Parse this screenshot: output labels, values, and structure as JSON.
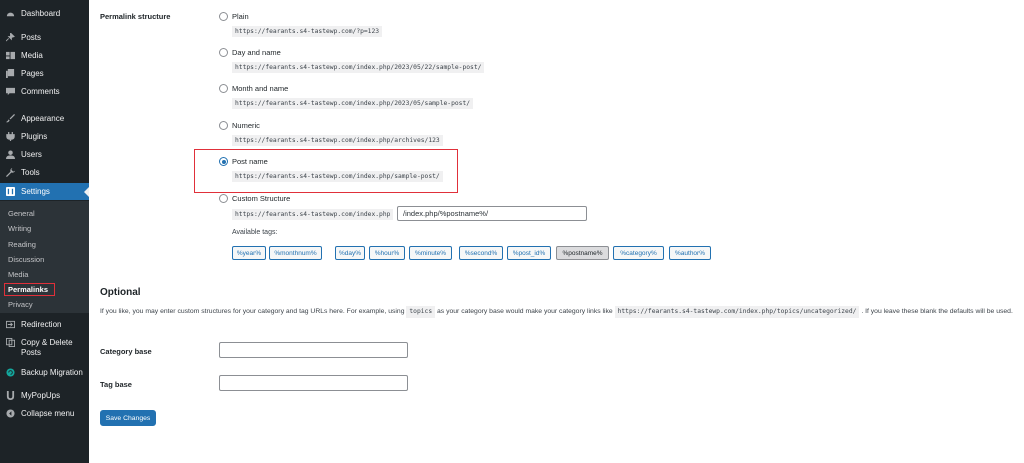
{
  "sidebar": {
    "items": [
      {
        "label": "Dashboard",
        "icon": "dashboard-icon"
      },
      {
        "label": "Posts",
        "icon": "pin-icon"
      },
      {
        "label": "Media",
        "icon": "media-icon"
      },
      {
        "label": "Pages",
        "icon": "pages-icon"
      },
      {
        "label": "Comments",
        "icon": "comment-icon"
      },
      {
        "label": "Appearance",
        "icon": "brush-icon"
      },
      {
        "label": "Plugins",
        "icon": "plug-icon"
      },
      {
        "label": "Users",
        "icon": "user-icon"
      },
      {
        "label": "Tools",
        "icon": "wrench-icon"
      },
      {
        "label": "Settings",
        "icon": "settings-icon"
      },
      {
        "label": "Redirection",
        "icon": "redirect-icon"
      },
      {
        "label": "Copy & Delete Posts",
        "icon": "copy-icon"
      },
      {
        "label": "Backup Migration",
        "icon": "backup-icon"
      },
      {
        "label": "MyPopUps",
        "icon": "u-icon"
      },
      {
        "label": "Collapse menu",
        "icon": "collapse-icon"
      }
    ],
    "settings_submenu": [
      "General",
      "Writing",
      "Reading",
      "Discussion",
      "Media",
      "Permalinks",
      "Privacy"
    ],
    "accent_color": "#2271b1"
  },
  "permalink": {
    "section_label": "Permalink structure",
    "options": [
      {
        "label": "Plain",
        "example": "https://fearants.s4-tastewp.com/?p=123",
        "selected": false
      },
      {
        "label": "Day and name",
        "example": "https://fearants.s4-tastewp.com/index.php/2023/05/22/sample-post/",
        "selected": false
      },
      {
        "label": "Month and name",
        "example": "https://fearants.s4-tastewp.com/index.php/2023/05/sample-post/",
        "selected": false
      },
      {
        "label": "Numeric",
        "example": "https://fearants.s4-tastewp.com/index.php/archives/123",
        "selected": false
      },
      {
        "label": "Post name",
        "example": "https://fearants.s4-tastewp.com/index.php/sample-post/",
        "selected": true
      },
      {
        "label": "Custom Structure",
        "example": "https://fearants.s4-tastewp.com/index.php",
        "selected": false
      }
    ],
    "custom_structure_value": "/index.php/%postname%/",
    "available_tags_label": "Available tags:",
    "tags": [
      "%year%",
      "%monthnum%",
      "%day%",
      "%hour%",
      "%minute%",
      "%second%",
      "%post_id%",
      "%postname%",
      "%category%",
      "%author%"
    ],
    "active_tag": "%postname%"
  },
  "optional": {
    "heading": "Optional",
    "desc_before": "If you like, you may enter custom structures for your category and tag URLs here. For example, using",
    "desc_code1": "topics",
    "desc_middle": "as your category base would make your category links like",
    "desc_code2": "https://fearants.s4-tastewp.com/index.php/topics/uncategorized/",
    "desc_after": ". If you leave these blank the defaults will be used.",
    "category_base_label": "Category base",
    "category_base_value": "",
    "tag_base_label": "Tag base",
    "tag_base_value": ""
  },
  "save_button_label": "Save Changes",
  "highlight_color": "#e0303a"
}
